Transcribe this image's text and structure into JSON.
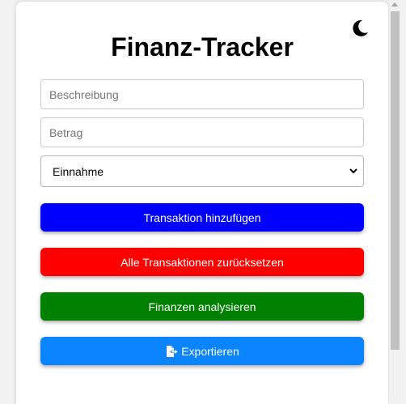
{
  "header": {
    "title": "Finanz-Tracker"
  },
  "form": {
    "description_placeholder": "Beschreibung",
    "amount_placeholder": "Betrag",
    "type_selected": "Einnahme"
  },
  "buttons": {
    "add_label": "Transaktion hinzufügen",
    "reset_label": "Alle Transaktionen zurücksetzen",
    "analyze_label": "Finanzen analysieren",
    "export_label": "Exportieren"
  },
  "colors": {
    "add": "#0000ff",
    "reset": "#ff0000",
    "analyze": "#008000",
    "export": "#0a84ff"
  },
  "icons": {
    "theme_toggle": "moon-icon",
    "export": "file-export-icon",
    "select": "chevron-down-icon"
  }
}
